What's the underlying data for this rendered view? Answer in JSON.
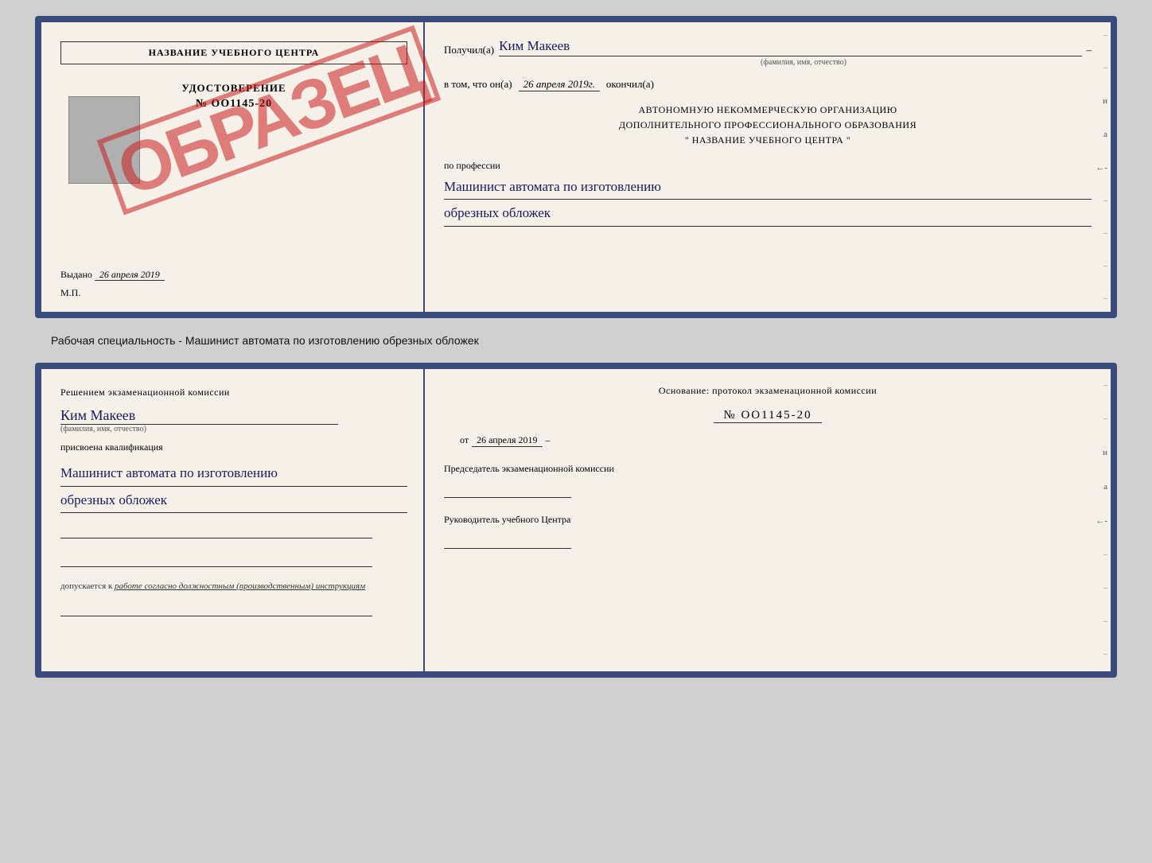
{
  "top_doc": {
    "left": {
      "school_name": "НАЗВАНИЕ УЧЕБНОГО ЦЕНТРА",
      "cert_title": "УДОСТОВЕРЕНИЕ",
      "cert_number": "№ OO1145-20",
      "stamp": "ОБРАЗЕЦ",
      "issued_label": "Выдано",
      "issued_date": "26 апреля 2019",
      "mp_label": "М.П."
    },
    "right": {
      "received_label": "Получил(а)",
      "recipient_name": "Ким Макеев",
      "name_subtitle": "(фамилия, имя, отчество)",
      "date_intro": "в том, что он(а)",
      "date_value": "26 апреля 2019г.",
      "finished_label": "окончил(а)",
      "org_line1": "АВТОНОМНУЮ НЕКОММЕРЧЕСКУЮ ОРГАНИЗАЦИЮ",
      "org_line2": "ДОПОЛНИТЕЛЬНОГО ПРОФЕССИОНАЛЬНОГО ОБРАЗОВАНИЯ",
      "org_name": "\"   НАЗВАНИЕ УЧЕБНОГО ЦЕНТРА   \"",
      "profession_label": "по профессии",
      "profession_line1": "Машинист автомата по изготовлению",
      "profession_line2": "обрезных обложек"
    }
  },
  "middle_caption": "Рабочая специальность - Машинист автомата по изготовлению обрезных обложек",
  "bottom_doc": {
    "left": {
      "commission_text": "Решением экзаменационной комиссии",
      "person_name": "Ким Макеев",
      "name_subtitle": "(фамилия, имя, отчество)",
      "qualification_label": "присвоена квалификация",
      "qualification_line1": "Машинист автомата по изготовлению",
      "qualification_line2": "обрезных обложек",
      "allowed_label": "допускается к",
      "allowed_text": "работе согласно должностным (производственным) инструкциям"
    },
    "right": {
      "basis_label": "Основание: протокол экзаменационной комиссии",
      "protocol_number": "№  OO1145-20",
      "date_from_label": "от",
      "date_from_value": "26 апреля 2019",
      "chairman_label": "Председатель экзаменационной комиссии",
      "director_label": "Руководитель учебного Центра"
    }
  }
}
